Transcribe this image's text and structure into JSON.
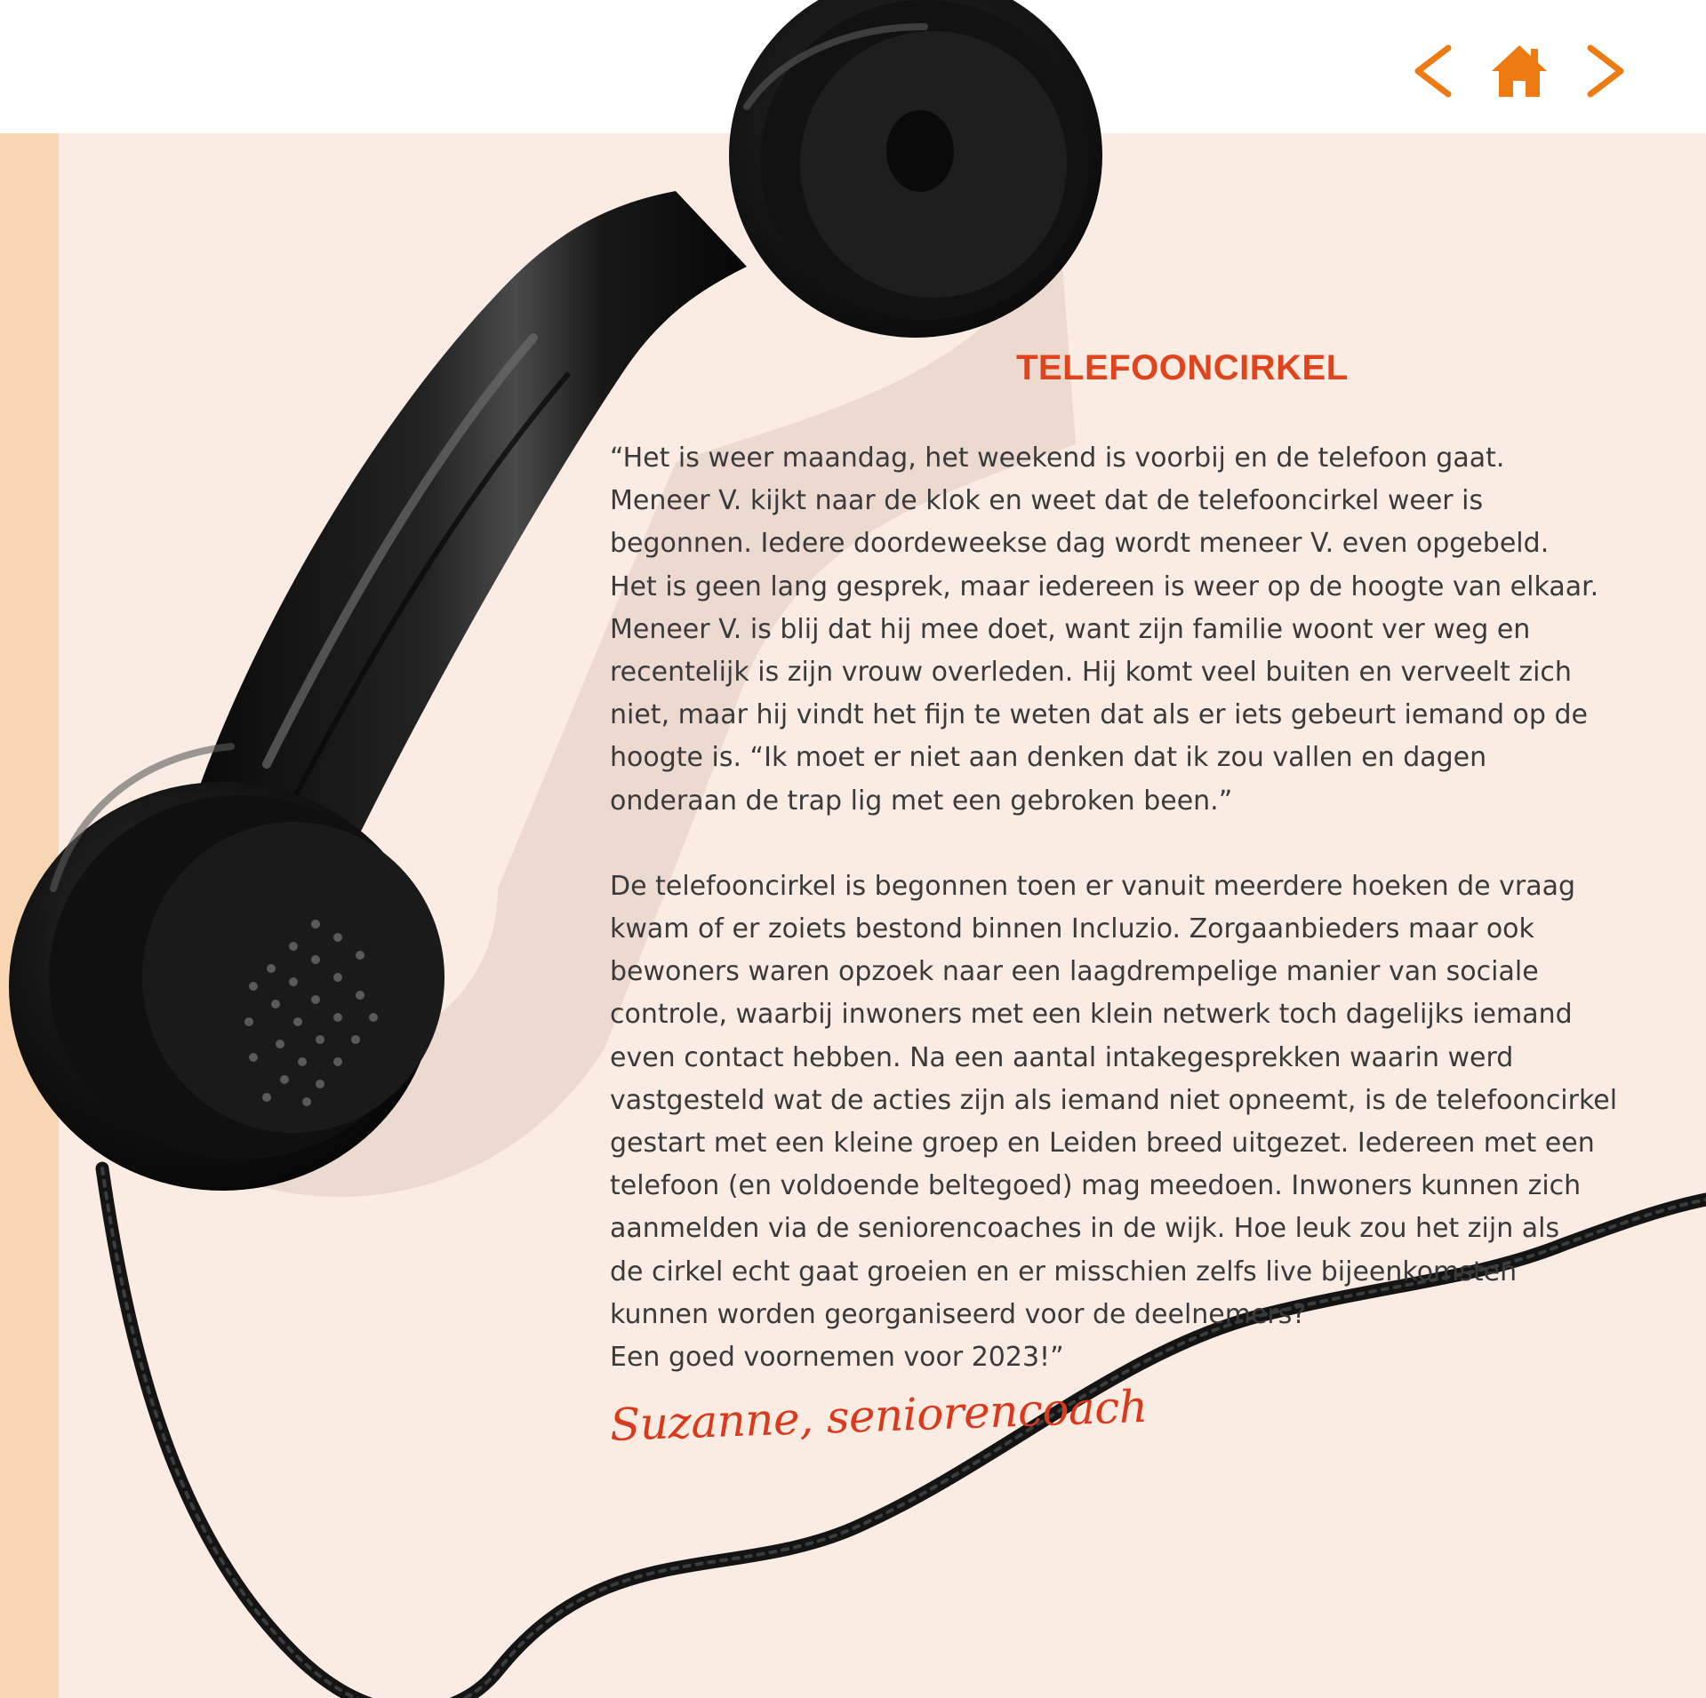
{
  "navigation": {
    "previous_icon": "chevron-left-icon",
    "home_icon": "home-icon",
    "next_icon": "chevron-right-icon",
    "accent_color": "#ee7b12"
  },
  "article": {
    "title": "TELEFOONCIRKEL",
    "paragraphs": [
      "“Het is weer maandag, het weekend is voorbij en de telefoon gaat.\nMeneer V. kijkt naar de klok en weet dat de telefooncirkel weer is\nbegonnen. Iedere doordeweekse dag wordt meneer V. even opgebeld.\nHet is geen lang gesprek, maar iedereen is weer op de hoogte van elkaar.\nMeneer V. is blij dat hij mee doet, want zijn familie woont ver weg en\nrecentelijk is zijn vrouw overleden. Hij komt veel buiten en verveelt zich\nniet, maar hij vindt het fijn te weten dat als er iets gebeurt iemand op de\nhoogte is. “Ik moet er niet aan denken dat ik zou vallen en dagen\nonderaan de trap lig met een gebroken been.”",
      "De telefooncirkel is begonnen toen er vanuit meerdere hoeken de vraag\nkwam of er zoiets bestond binnen Incluzio. Zorgaanbieders maar ook\nbewoners waren opzoek naar een laagdrempelige manier van sociale\ncontrole, waarbij inwoners met een klein netwerk toch dagelijks iemand\neven contact hebben. Na een aantal intakegesprekken waarin werd\nvastgesteld wat de acties zijn als iemand niet opneemt, is de telefooncirkel\ngestart met een kleine groep en Leiden breed uitgezet. Iedereen met een\ntelefoon (en voldoende beltegoed) mag meedoen. Inwoners kunnen zich\naanmelden via de seniorencoaches in de wijk. Hoe leuk zou het zijn als\nde cirkel echt gaat groeien en er misschien zelfs live bijeenkomsten\nkunnen worden georganiseerd voor de deelnemers?\nEen goed voornemen voor 2023!”"
    ],
    "signature": "Suzanne, seniorencoach"
  },
  "colors": {
    "title": "#e0441c",
    "signature": "#d93a1c",
    "background": "#fbece3",
    "side_band": "#f8d6b3"
  }
}
